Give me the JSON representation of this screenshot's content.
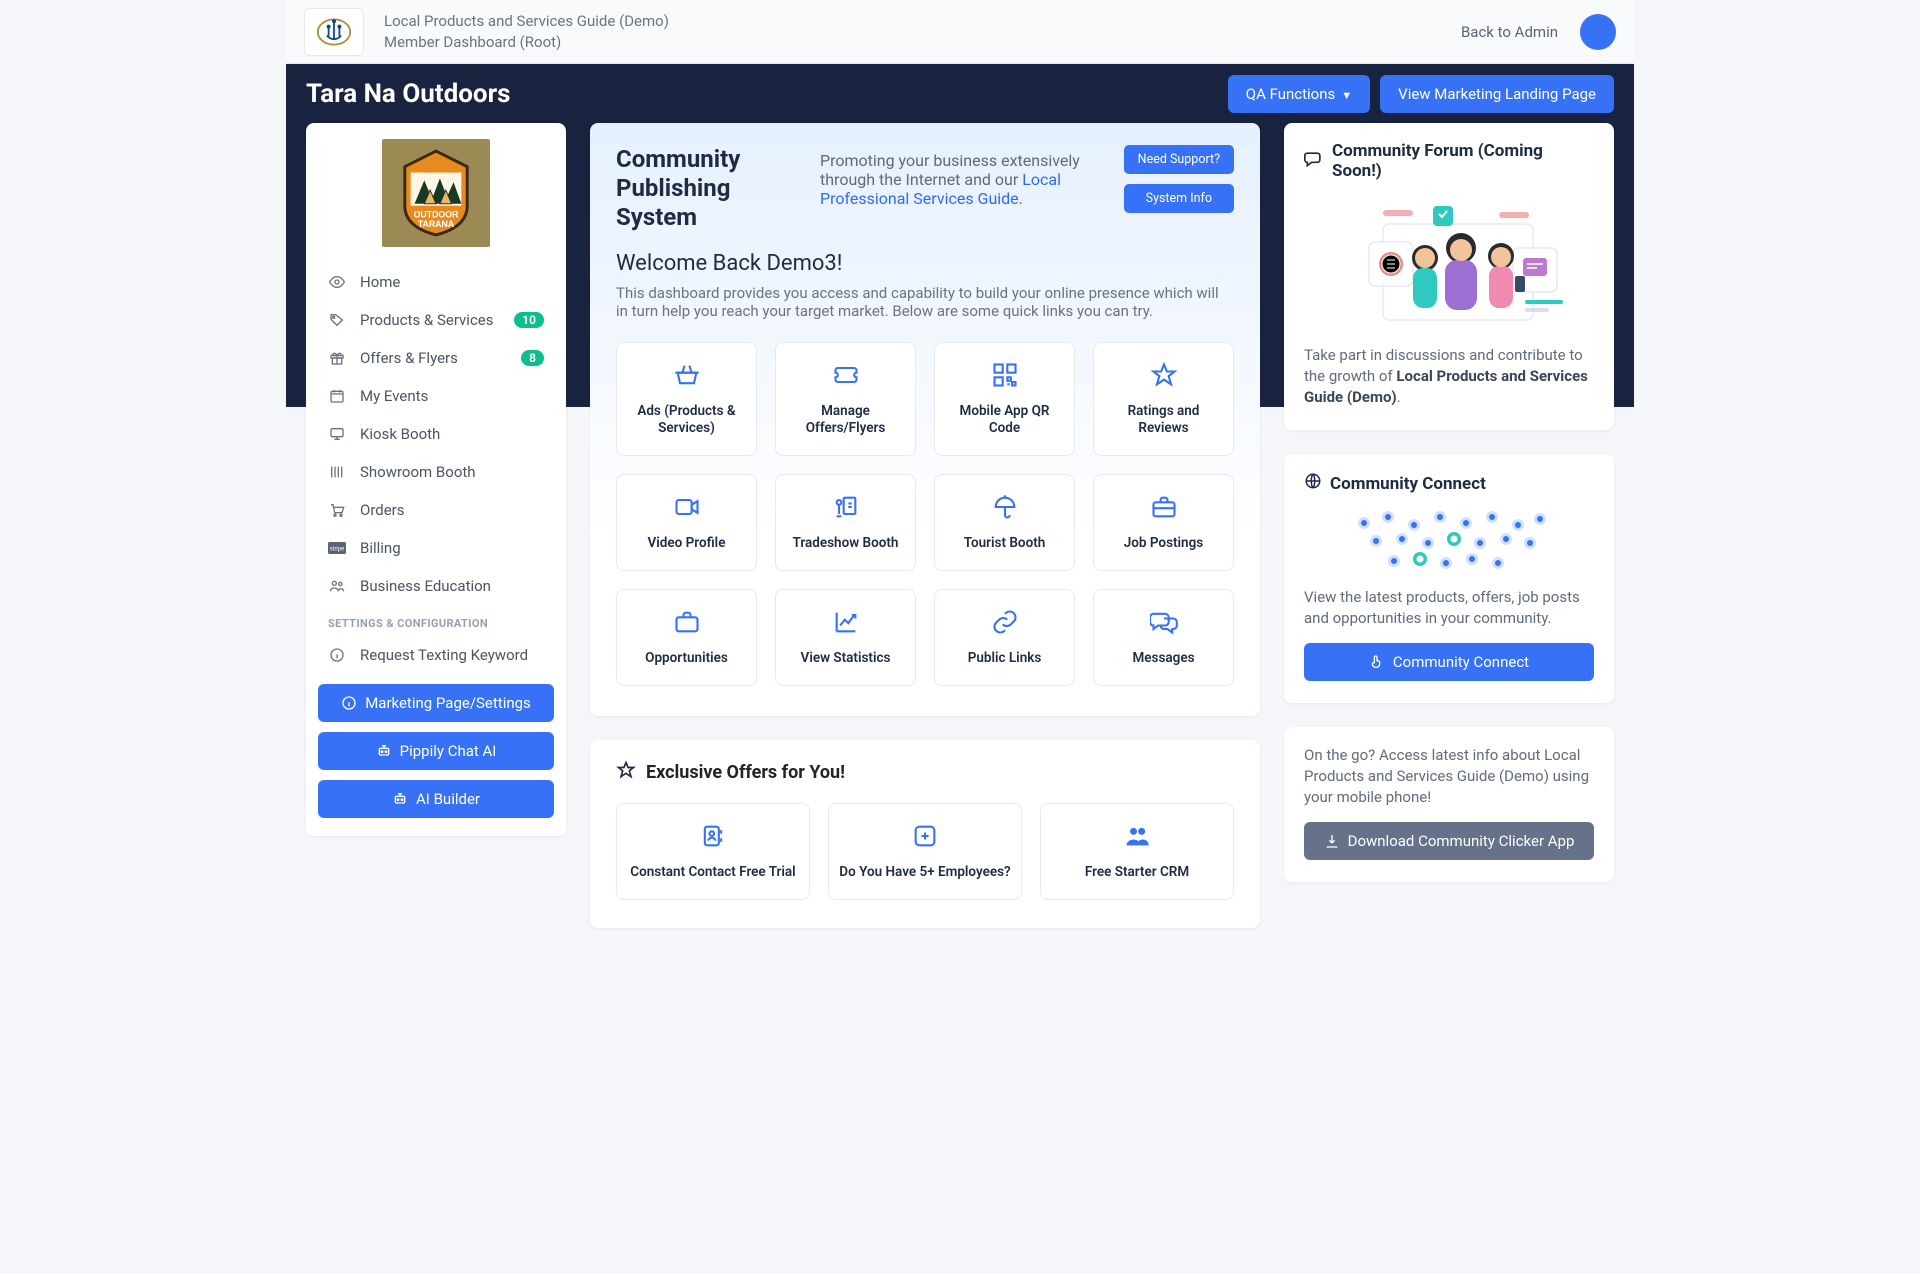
{
  "topbar": {
    "title1": "Local Products and Services Guide (Demo)",
    "title2": "Member Dashboard (Root)",
    "back": "Back to Admin"
  },
  "banner": {
    "workspace": "Tara Na Outdoors",
    "qa_label": "QA Functions",
    "view_landing": "View Marketing Landing Page"
  },
  "sidebar": {
    "logo_text_top": "OUTDOOR",
    "logo_text_bottom": "TARANA",
    "items": [
      {
        "label": "Home"
      },
      {
        "label": "Products & Services",
        "badge": "10"
      },
      {
        "label": "Offers & Flyers",
        "badge": "8"
      },
      {
        "label": "My Events"
      },
      {
        "label": "Kiosk Booth"
      },
      {
        "label": "Showroom Booth"
      },
      {
        "label": "Orders"
      },
      {
        "label": "Billing"
      },
      {
        "label": "Business Education"
      }
    ],
    "config_heading": "SETTINGS & CONFIGURATION",
    "config_items": [
      {
        "label": "Request Texting Keyword"
      }
    ],
    "buttons": {
      "marketing": "Marketing Page/Settings",
      "pippily": "Pippily Chat AI",
      "ai_builder": "AI Builder"
    }
  },
  "hero": {
    "title": "Community Publishing System",
    "promo_pre": "Promoting your business extensively through the Internet and our ",
    "promo_link": "Local Professional Services Guide",
    "promo_post": ".",
    "need_support": "Need Support?",
    "system_info": "System Info",
    "welcome": "Welcome Back Demo3!",
    "desc": "This dashboard provides you access and capability to build your online presence which will in turn help you reach your target market. Below are some quick links you can try.",
    "tiles": [
      "Ads (Products & Services)",
      "Manage Offers/Flyers",
      "Mobile App QR Code",
      "Ratings and Reviews",
      "Video Profile",
      "Tradeshow Booth",
      "Tourist Booth",
      "Job Postings",
      "Opportunities",
      "View Statistics",
      "Public Links",
      "Messages"
    ]
  },
  "offers": {
    "heading": "Exclusive Offers for You!",
    "tiles": [
      "Constant Contact Free Trial",
      "Do You Have 5+ Employees?",
      "Free Starter CRM"
    ]
  },
  "right": {
    "forum": {
      "title": "Community Forum (Coming Soon!)",
      "text_pre": "Take part in discussions and contribute to the growth of ",
      "text_bold": "Local Products and Services Guide (Demo)",
      "text_post": "."
    },
    "connect": {
      "title": "Community Connect",
      "text": "View the latest products, offers, job posts and opportunities in your community.",
      "button": "Community Connect"
    },
    "clicker": {
      "text": "On the go? Access latest info about Local Products and Services Guide (Demo) using your mobile phone!",
      "button": "Download Community Clicker App"
    }
  }
}
